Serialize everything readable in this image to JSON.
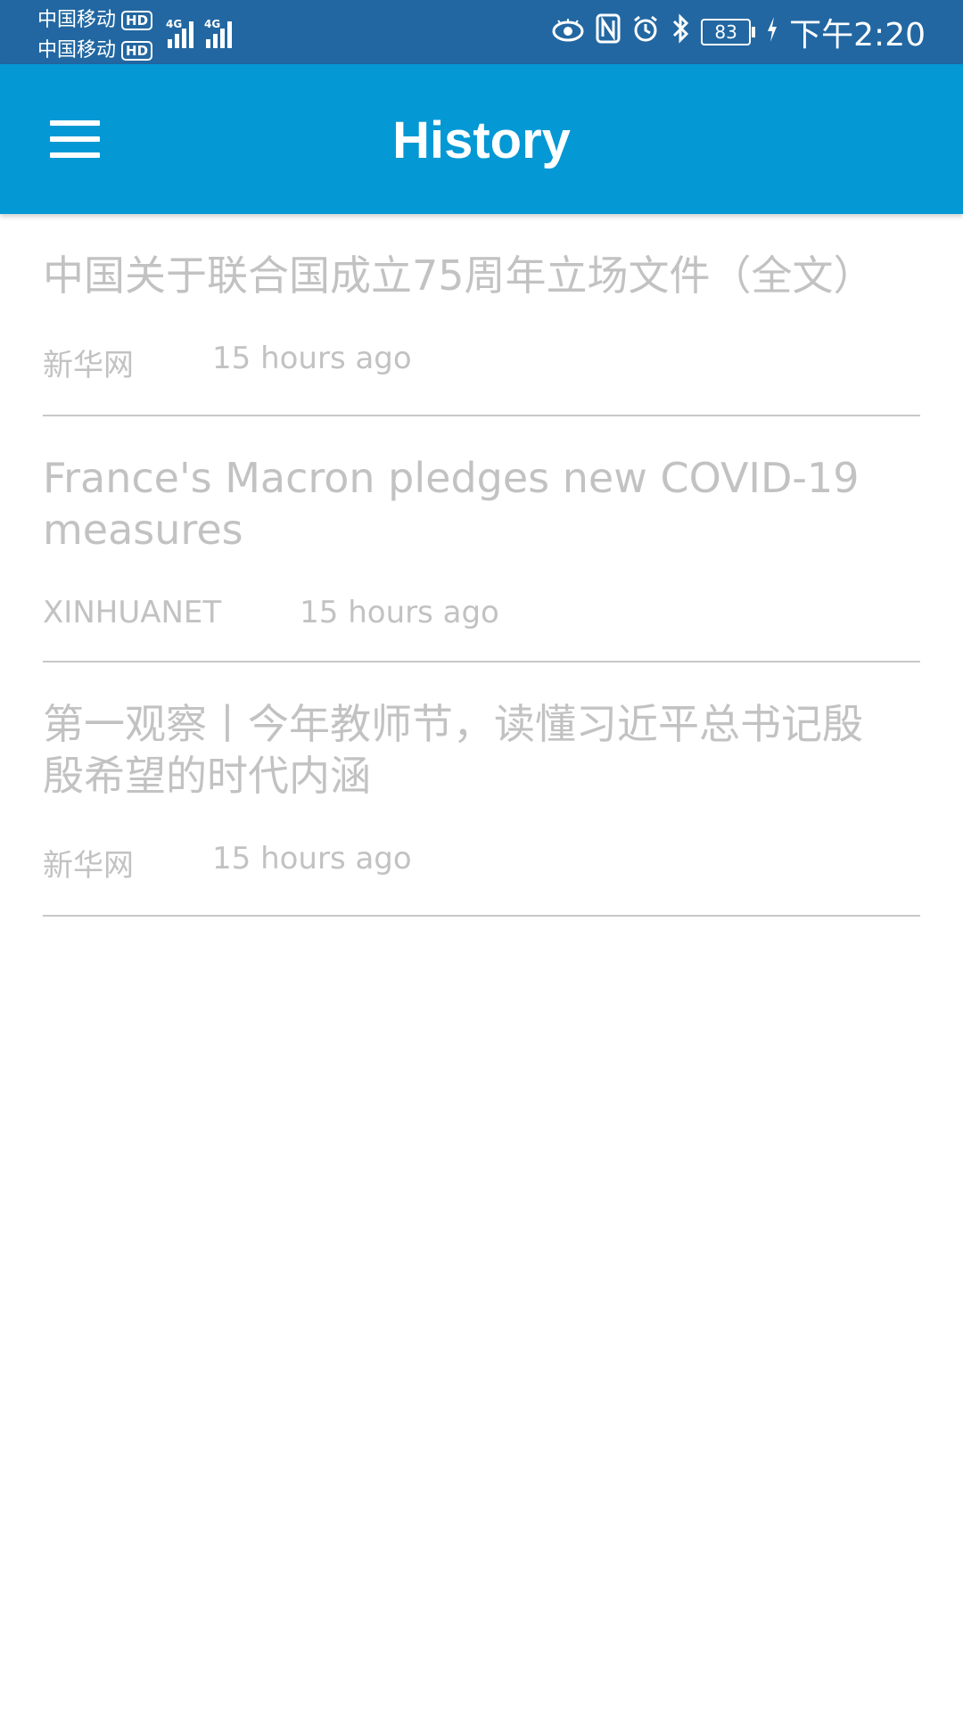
{
  "status_bar": {
    "carriers": [
      {
        "name": "中国移动",
        "badge": "HD"
      },
      {
        "name": "中国移动",
        "badge": "HD"
      }
    ],
    "signals": [
      {
        "network": "4G",
        "level": 4
      },
      {
        "network": "4G",
        "level": 4
      }
    ],
    "icons": [
      "eye-icon",
      "nfc-icon",
      "alarm-icon",
      "bluetooth-icon"
    ],
    "battery": "83",
    "time": "下午2:20"
  },
  "app_bar": {
    "title": "History",
    "menu_icon": "hamburger-menu-icon",
    "background": "#0498d5"
  },
  "history": [
    {
      "title": "中国关于联合国成立75周年立场文件（全文）",
      "source": "新华网",
      "time": "15 hours ago"
    },
    {
      "title": "France's Macron pledges new COVID-19 measures",
      "source": "XINHUANET",
      "time": "15 hours ago"
    },
    {
      "title": "第一观察丨今年教师节，读懂习近平总书记殷殷希望的时代内涵",
      "source": "新华网",
      "time": "15 hours ago"
    }
  ]
}
